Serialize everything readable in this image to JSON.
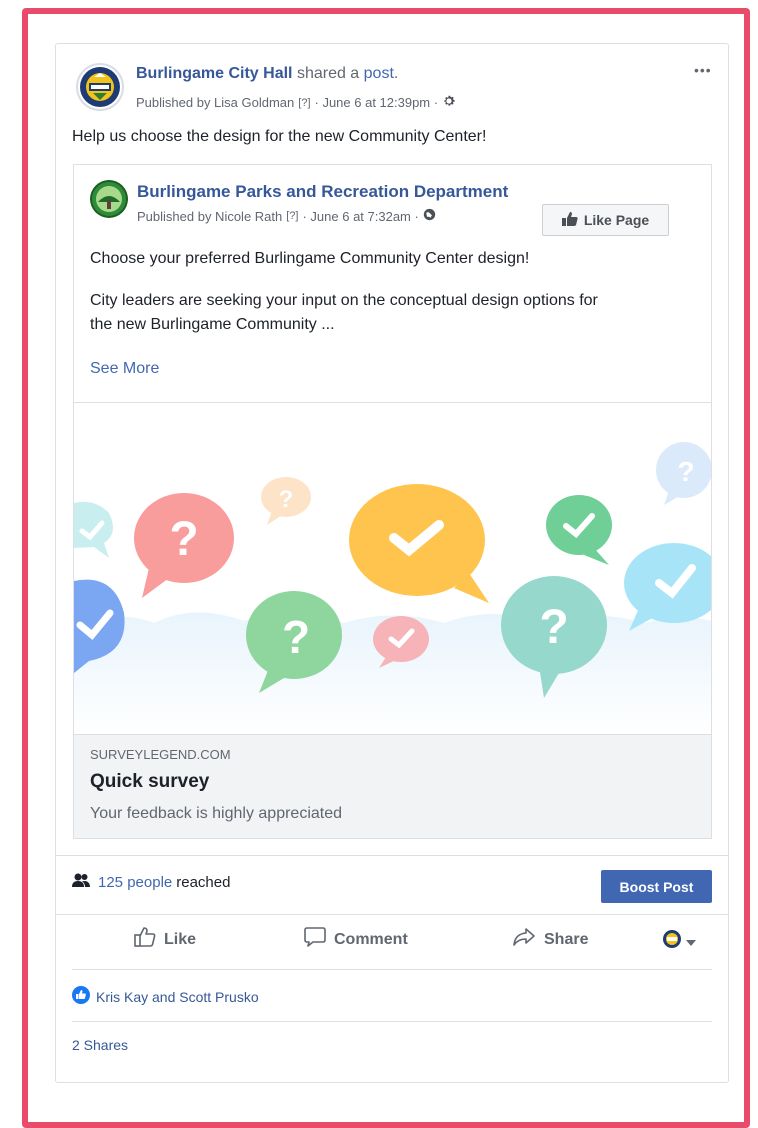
{
  "post": {
    "page_name": "Burlingame City Hall",
    "shared_text": "shared a",
    "post_link": "post",
    "post_period": ".",
    "published_by": "Published by Lisa Goldman",
    "help_marker": "[?]",
    "date": "· June 6 at 12:39pm ·",
    "more_label": "•••",
    "message": "Help us choose the design for the new Community Center!"
  },
  "shared_post": {
    "page_name": "Burlingame Parks and Recreation Department",
    "published_by": "Published by Nicole Rath",
    "help_marker": "[?]",
    "date": "· June 6 at 7:32am ·",
    "like_page_label": "Like Page",
    "headline": "Choose your preferred Burlingame Community Center design!",
    "body_line1": "City leaders are seeking your input on the conceptual design options for",
    "body_line2": "the new Burlingame Community ...",
    "see_more": "See More"
  },
  "link_preview": {
    "domain": "SURVEYLEGEND.COM",
    "title": "Quick survey",
    "description": "Your feedback is highly appreciated"
  },
  "reach": {
    "count_link": "125 people",
    "suffix": "reached",
    "boost_label": "Boost Post"
  },
  "actions": {
    "like": "Like",
    "comment": "Comment",
    "share": "Share"
  },
  "reactions": {
    "names": "Kris Kay and Scott Prusko",
    "shares": "2 Shares"
  },
  "colors": {
    "frame": "#e94b6a",
    "link": "#365899",
    "accent": "#4267b2"
  }
}
